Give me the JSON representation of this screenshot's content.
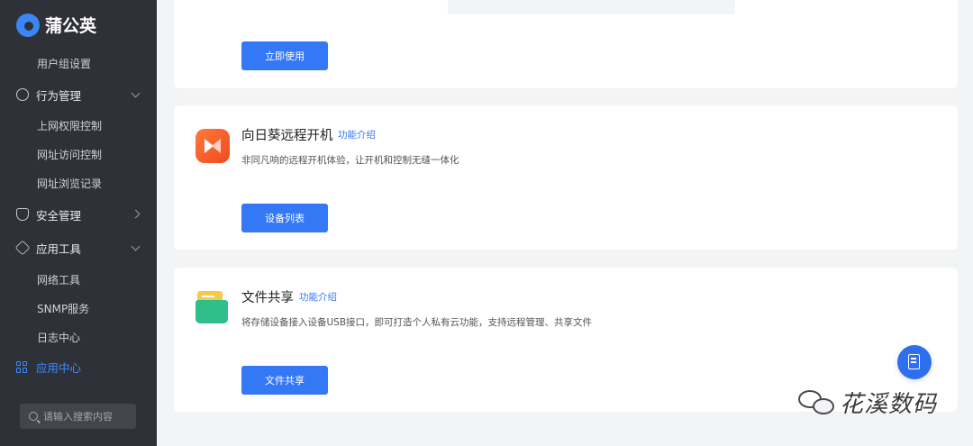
{
  "brand": {
    "name": "蒲公英"
  },
  "sidebar": {
    "items": [
      {
        "label": "用户组设置"
      },
      {
        "label": "行为管理"
      },
      {
        "label": "上网权限控制"
      },
      {
        "label": "网址访问控制"
      },
      {
        "label": "网址浏览记录"
      },
      {
        "label": "安全管理"
      },
      {
        "label": "应用工具"
      },
      {
        "label": "网络工具"
      },
      {
        "label": "SNMP服务"
      },
      {
        "label": "日志中心"
      },
      {
        "label": "应用中心"
      }
    ],
    "search_placeholder": "请输入搜索内容"
  },
  "cards": [
    {
      "button": "立即使用"
    },
    {
      "title": "向日葵远程开机",
      "link": "功能介绍",
      "desc": "非同凡响的远程开机体验，让开机和控制无缝一体化",
      "button": "设备列表"
    },
    {
      "title": "文件共享",
      "link": "功能介绍",
      "desc": "将存储设备接入设备USB接口，即可打造个人私有云功能，支持远程管理、共享文件",
      "button": "文件共享"
    }
  ],
  "watermark": {
    "text": "花溪数码"
  },
  "colors": {
    "accent": "#3478f6",
    "sidebar_bg": "#2f3138",
    "active": "#3d8bff"
  },
  "icons": {
    "sun_app": "sunlogin-icon",
    "file_app": "folder-icon",
    "fab": "document-edit-icon"
  }
}
